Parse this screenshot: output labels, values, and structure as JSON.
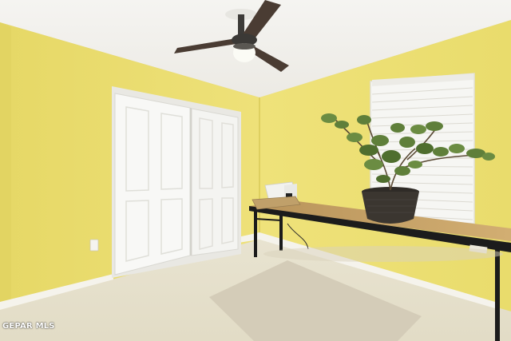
{
  "watermark": {
    "text": "GEPAR MLS"
  },
  "colors": {
    "wall": "#ecdf6e",
    "wall_shadow": "#dccf5c",
    "ceiling": "#f3f2ee",
    "floor": "#e6e0cc",
    "rug": "#d3cbb6",
    "door": "#f7f7f5",
    "baseboard": "#f6f5ee",
    "table_top": "#c9a466",
    "table_frame": "#1b1b1b",
    "pot": "#3a352f",
    "leaves": "#5e7f3a"
  }
}
